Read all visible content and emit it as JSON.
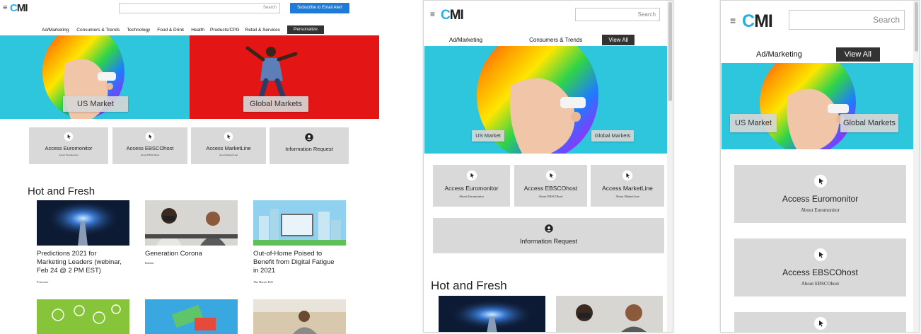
{
  "brand": {
    "logo_c": "C",
    "logo_mi": "MI",
    "menu_glyph": "≡"
  },
  "search": {
    "placeholder": "Search"
  },
  "subscribe_label": "Subscribe to Email Alert",
  "desktop_nav": [
    "Ad/Marketing",
    "Consumers & Trends",
    "Technology",
    "Food & Drink",
    "Health",
    "Products/CPG",
    "Retail & Services"
  ],
  "personalize_label": "Personalize",
  "tablet_nav": [
    "Ad/Marketing",
    "Consumers & Trends"
  ],
  "mobile_nav": [
    "Ad/Marketing"
  ],
  "view_all_label": "View All",
  "hero": {
    "us_market": "US Market",
    "global_markets": "Global Markets"
  },
  "tiles": [
    {
      "title": "Access Euromonitor",
      "sub": "About Euromonitor"
    },
    {
      "title": "Access EBSCOhost",
      "sub": "About EBSCOhost"
    },
    {
      "title": "Access MarketLine",
      "sub": "About MarketLine"
    },
    {
      "title": "Information Request",
      "sub": ""
    }
  ],
  "section_title": "Hot and Fresh",
  "cards": [
    {
      "title_lines": [
        "Predictions 2021 for",
        "Marketing Leaders (webinar,",
        "Feb 24 @ 2 PM EST)"
      ],
      "source": "Forrester"
    },
    {
      "title_lines": [
        "Generation Corona"
      ],
      "source": "Kantar"
    },
    {
      "title_lines": [
        "Out-of-Home Poised to",
        "Benefit from Digital Fatigue",
        "in 2021"
      ],
      "source": "The Harris Poll"
    }
  ],
  "colors": {
    "accent": "#29aee6",
    "subscribe": "#1e7bd7",
    "hero_cyan": "#2ec6dc",
    "hero_red": "#e31515",
    "tile_bg": "#d9d9d9",
    "pill_bg": "#333333"
  },
  "icons": [
    "menu-icon",
    "cursor-click-icon",
    "user-icon"
  ]
}
